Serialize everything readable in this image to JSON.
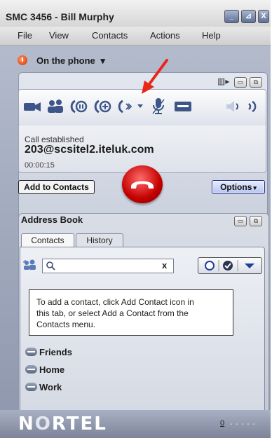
{
  "window": {
    "title": "SMC 3456 - Bill Murphy"
  },
  "menu": [
    "File",
    "View",
    "Contacts",
    "Actions",
    "Help"
  ],
  "presence": {
    "status": "On the phone",
    "caret": "▾"
  },
  "call": {
    "status": "Call established",
    "address": "203@scsitel2.iteluk.com",
    "timer": "00:00:15"
  },
  "buttons": {
    "add_to_contacts": "Add to Contacts",
    "options": "Options"
  },
  "address_book": {
    "title": "Address Book",
    "tabs": [
      "Contacts",
      "History"
    ],
    "search": {
      "value": "",
      "clear": "x"
    },
    "info": [
      "To add a contact, click Add Contact icon in",
      "this tab, or select Add a Contact from the",
      "Contacts menu."
    ],
    "groups": [
      "Friends",
      "Home",
      "Work"
    ]
  },
  "footer": {
    "logo_prefix": "N",
    "logo_o": "O",
    "logo_suffix": "RTEL",
    "page_number": "0",
    "dots": "- - - - -"
  },
  "colors": {
    "accent": "#3d5588",
    "hangup": "#c40000",
    "annotation": "#e8261a"
  }
}
